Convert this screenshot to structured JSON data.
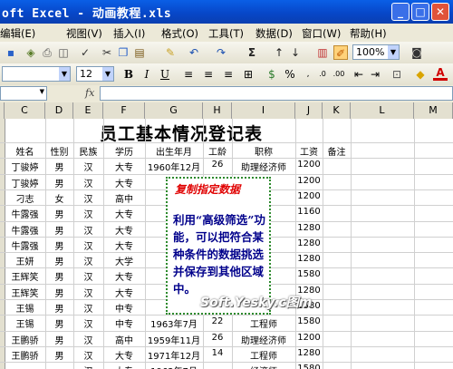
{
  "window": {
    "title": "oft Excel - 动画教程.xls"
  },
  "menu": [
    "编辑(E)",
    "视图(V)",
    "插入(I)",
    "格式(O)",
    "工具(T)",
    "数据(D)",
    "窗口(W)",
    "帮助(H)"
  ],
  "toolbar": {
    "zoom": "100%"
  },
  "format_toolbar": {
    "font_size": "12",
    "bold": "B",
    "italic": "I",
    "underline": "U"
  },
  "formula_bar": {
    "fx": "fx"
  },
  "columns": [
    "C",
    "D",
    "E",
    "F",
    "G",
    "H",
    "I",
    "J",
    "K",
    "L",
    "M"
  ],
  "sheet": {
    "title": "员工基本情况登记表",
    "headers": [
      "姓名",
      "性别",
      "民族",
      "学历",
      "出生年月",
      "工龄",
      "职称",
      "工资",
      "备注"
    ],
    "rows": [
      [
        "丁骏婷",
        "男",
        "汉",
        "大专",
        "1960年12月",
        "26",
        "助理经济师",
        "1200",
        ""
      ],
      [
        "丁骏婷",
        "男",
        "汉",
        "大专",
        "195",
        "",
        "",
        "1200",
        ""
      ],
      [
        "刁志",
        "女",
        "汉",
        "高中",
        "196",
        "",
        "",
        "1200",
        ""
      ],
      [
        "牛露强",
        "男",
        "汉",
        "大专",
        "196",
        "",
        "",
        "1160",
        ""
      ],
      [
        "牛露强",
        "男",
        "汉",
        "大专",
        "196",
        "",
        "",
        "1280",
        ""
      ],
      [
        "牛露强",
        "男",
        "汉",
        "大专",
        "196",
        "",
        "",
        "1280",
        ""
      ],
      [
        "王妍",
        "男",
        "汉",
        "大学",
        "197",
        "",
        "",
        "1280",
        ""
      ],
      [
        "王辉笑",
        "男",
        "汉",
        "大专",
        "196",
        "",
        "",
        "1580",
        ""
      ],
      [
        "王辉笑",
        "男",
        "汉",
        "大专",
        "194",
        "",
        "",
        "1280",
        ""
      ],
      [
        "王锡",
        "男",
        "汉",
        "中专",
        "195",
        "",
        "",
        "1580",
        ""
      ],
      [
        "王锡",
        "男",
        "汉",
        "中专",
        "1963年7月",
        "22",
        "工程师",
        "1580",
        ""
      ],
      [
        "王鹏骄",
        "男",
        "汉",
        "高中",
        "1959年11月",
        "26",
        "助理经济师",
        "1200",
        ""
      ],
      [
        "王鹏骄",
        "男",
        "汉",
        "大专",
        "1971年12月",
        "14",
        "工程师",
        "1280",
        ""
      ],
      [
        "",
        "",
        "汉",
        "大专",
        "1963年7月",
        "",
        "经济师",
        "1580",
        ""
      ]
    ]
  },
  "callout": {
    "title": "复制指定数据",
    "body": "利用“高级筛选”功能，可以把符合某种条件的数据挑选并保存到其他区域中。"
  },
  "watermark": "Soft.Yesky.c图m"
}
